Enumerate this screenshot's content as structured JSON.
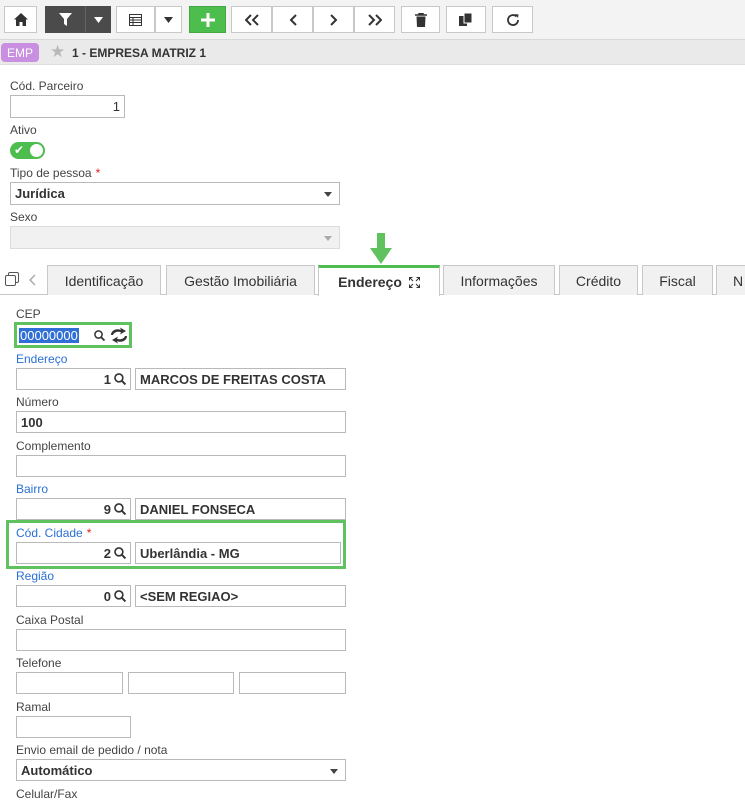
{
  "company": {
    "badge": "EMP",
    "title": "1 - EMPRESA MATRIZ 1"
  },
  "header_form": {
    "cod_parceiro_label": "Cód. Parceiro",
    "cod_parceiro_value": "1",
    "ativo_label": "Ativo",
    "ativo_checked": true,
    "tipo_pessoa_label": "Tipo de pessoa",
    "tipo_pessoa_value": "Jurídica",
    "sexo_label": "Sexo",
    "sexo_value": "",
    "required_mark": "*"
  },
  "tabs": [
    {
      "label": "Identificação"
    },
    {
      "label": "Gestão Imobiliária"
    },
    {
      "label": "Endereço",
      "active": true
    },
    {
      "label": "Informações"
    },
    {
      "label": "Crédito"
    },
    {
      "label": "Fiscal"
    },
    {
      "label": "N"
    }
  ],
  "endereco": {
    "cep_label": "CEP",
    "cep_value": "00000000",
    "endereco_label": "Endereço",
    "endereco_code": "1",
    "endereco_name": "MARCOS DE FREITAS COSTA",
    "numero_label": "Número",
    "numero_value": "100",
    "complemento_label": "Complemento",
    "complemento_value": "",
    "bairro_label": "Bairro",
    "bairro_code": "9",
    "bairro_name": "DANIEL FONSECA",
    "cidade_label": "Cód. Cidade",
    "cidade_code": "2",
    "cidade_name": "Uberlândia - MG",
    "regiao_label": "Região",
    "regiao_code": "0",
    "regiao_name": "<SEM REGIAO>",
    "caixa_postal_label": "Caixa Postal",
    "caixa_postal_value": "",
    "telefone_label": "Telefone",
    "ramal_label": "Ramal",
    "envio_label": "Envio email de pedido / nota",
    "envio_value": "Automático",
    "celular_label": "Celular/Fax"
  },
  "colors": {
    "accent_green": "#4dbd4d",
    "link_blue": "#2a6fd6",
    "badge_purple": "#c98fe0",
    "required_red": "#e02020"
  }
}
